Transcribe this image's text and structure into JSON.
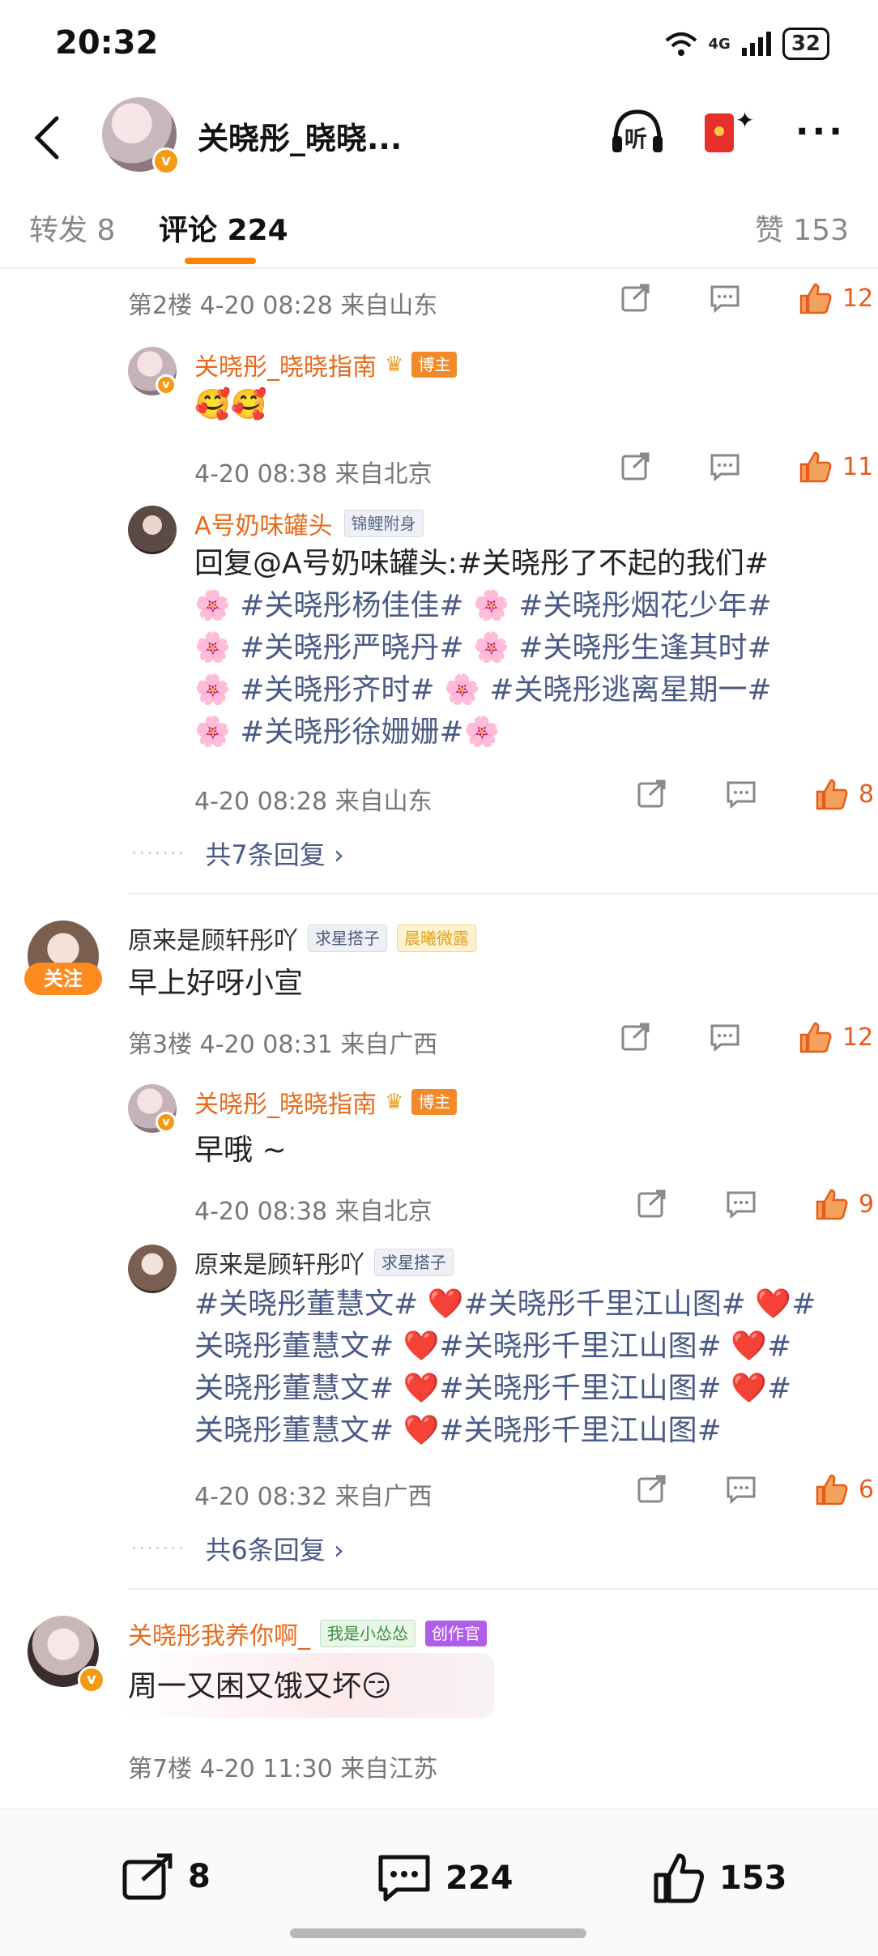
{
  "status": {
    "time": "20:32",
    "network": "4G",
    "battery": "32"
  },
  "header": {
    "title": "关晓彤_晓晓...",
    "listen_label": "听"
  },
  "tabs": {
    "repost": "转发 8",
    "comments": "评论 224",
    "likes": "赞 153"
  },
  "c2": {
    "meta": "第2楼  4-20 08:28  来自山东",
    "likes": "12"
  },
  "r1": {
    "name": "关晓彤_晓晓指南",
    "badge": "博主",
    "text": "🥰🥰",
    "meta": "4-20 08:38  来自北京",
    "likes": "11"
  },
  "r2": {
    "name": "A号奶味罐头",
    "badge": "锦鲤附身",
    "lines": [
      "回复@A号奶味罐头:#关晓彤了不起的我们#",
      "🌸 #关晓彤杨佳佳# 🌸 #关晓彤烟花少年#",
      "🌸 #关晓彤严晓丹# 🌸 #关晓彤生逢其时#",
      "🌸 #关晓彤齐时# 🌸 #关晓彤逃离星期一#",
      "🌸 #关晓彤徐姗姗#🌸"
    ],
    "meta": "4-20 08:28  来自山东",
    "likes": "8"
  },
  "more1": "共7条回复 ›",
  "c3": {
    "name": "原来是顾轩彤吖",
    "badge1": "求星搭子",
    "badge2": "晨曦微露",
    "follow": "关注",
    "text": "早上好呀小宣",
    "meta": "第3楼  4-20 08:31  来自广西",
    "likes": "12"
  },
  "r3": {
    "name": "关晓彤_晓晓指南",
    "badge": "博主",
    "text": "早哦 ~",
    "meta": "4-20 08:38  来自北京",
    "likes": "9"
  },
  "r4": {
    "name": "原来是顾轩彤吖",
    "badge": "求星搭子",
    "lines": [
      "#关晓彤董慧文# ❤️#关晓彤千里江山图# ❤️#",
      "关晓彤董慧文# ❤️#关晓彤千里江山图# ❤️#",
      "关晓彤董慧文# ❤️#关晓彤千里江山图# ❤️#",
      "关晓彤董慧文# ❤️#关晓彤千里江山图#"
    ],
    "meta": "4-20 08:32  来自广西",
    "likes": "6"
  },
  "more2": "共6条回复 ›",
  "c7": {
    "name": "关晓彤我养你啊_",
    "badge1": "我是小怂怂",
    "badge2": "创作官",
    "text": "周一又困又饿又坏😏",
    "meta": "第7楼  4-20 11:30  来自江苏"
  },
  "bottom": {
    "reposts": "8",
    "comments": "224",
    "likes": "153"
  },
  "colors": {
    "accent": "#ff8200",
    "name_orange": "#e8691a",
    "link": "#4a5a86",
    "like": "#e65c1c"
  }
}
